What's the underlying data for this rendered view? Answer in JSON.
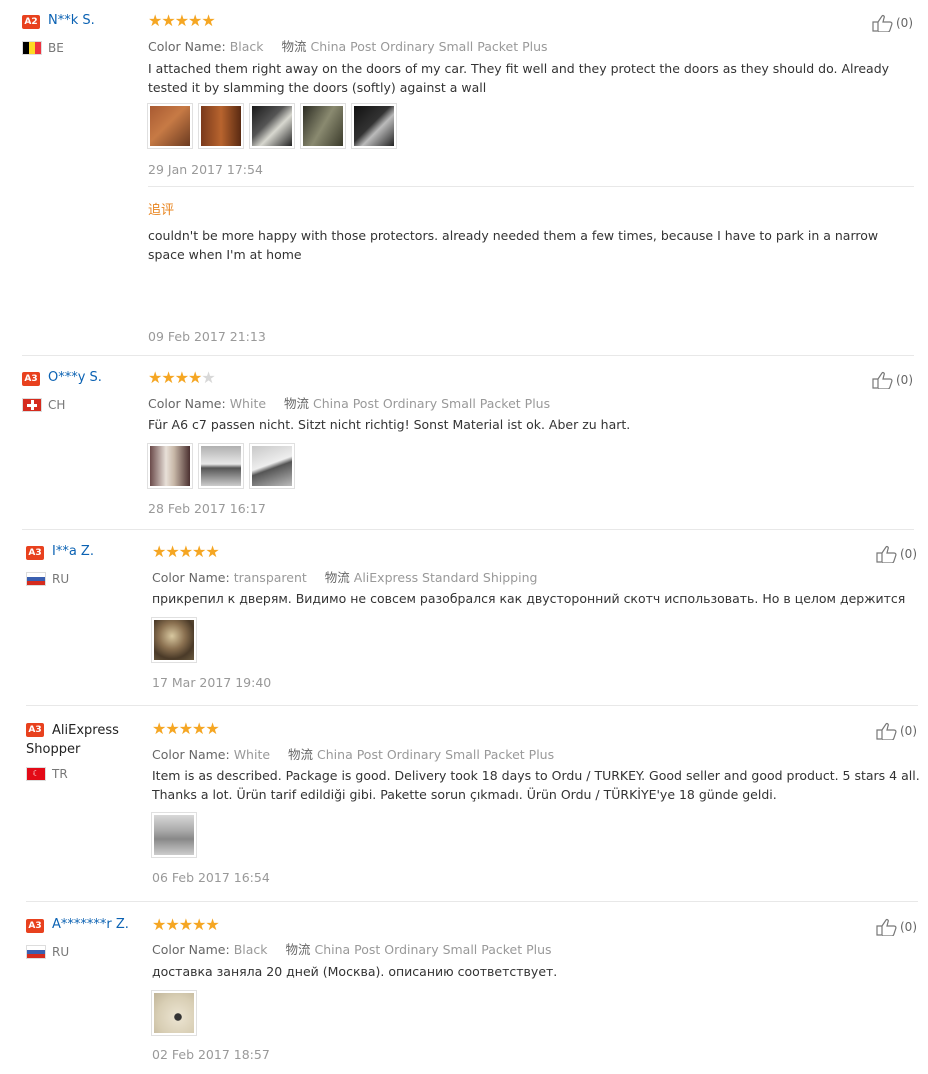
{
  "labels": {
    "color_name": "Color Name:",
    "shipping": "物流",
    "followup": "追评"
  },
  "reviews": [
    {
      "badge": "A2",
      "name": "N**k S.",
      "country": "BE",
      "rating": 5,
      "color": "Black",
      "shipping": "China Post Ordinary Small Packet Plus",
      "text": "I attached them right away on the doors of my car. They fit well and they protect the doors as they should do. Already tested it by slamming the doors (softly) against a wall",
      "date": "29 Jan 2017 17:54",
      "likes": "(0)",
      "followup_text": "couldn't be more happy with those protectors. already needed them a few times, because I have to park in a narrow space when I'm at home",
      "followup_date": "09 Feb 2017 21:13"
    },
    {
      "badge": "A3",
      "name": "O***y S.",
      "country": "CH",
      "rating": 4,
      "color": "White",
      "shipping": "China Post Ordinary Small Packet Plus",
      "text": "Für A6 c7 passen nicht. Sitzt nicht richtig! Sonst Material ist ok. Aber zu hart.",
      "date": "28 Feb 2017 16:17",
      "likes": "(0)"
    },
    {
      "badge": "A3",
      "name": "I**a Z.",
      "country": "RU",
      "rating": 5,
      "color": "transparent",
      "shipping": "AliExpress Standard Shipping",
      "text": "прикрепил к дверям. Видимо не совсем разобрался как двусторонний скотч использовать. Но в целом держится",
      "date": "17 Mar 2017 19:40",
      "likes": "(0)"
    },
    {
      "badge": "A3",
      "name": "AliExpress Shopper",
      "country": "TR",
      "rating": 5,
      "color": "White",
      "shipping": "China Post Ordinary Small Packet Plus",
      "text": "Item is as described. Package is good. Delivery took 18 days to Ordu / TURKEY. Good seller and good product. 5 stars 4 all. Thanks a lot. Ürün tarif edildiği gibi. Pakette sorun çıkmadı. Ürün Ordu / TÜRKİYE'ye 18 günde geldi.",
      "date": "06 Feb 2017 16:54",
      "likes": "(0)"
    },
    {
      "badge": "A3",
      "name": "A*******r Z.",
      "country": "RU",
      "rating": 5,
      "color": "Black",
      "shipping": "China Post Ordinary Small Packet Plus",
      "text": "доставка заняла 20 дней (Москва). описанию соответствует.",
      "date": "02 Feb 2017 18:57",
      "likes": "(0)"
    }
  ]
}
